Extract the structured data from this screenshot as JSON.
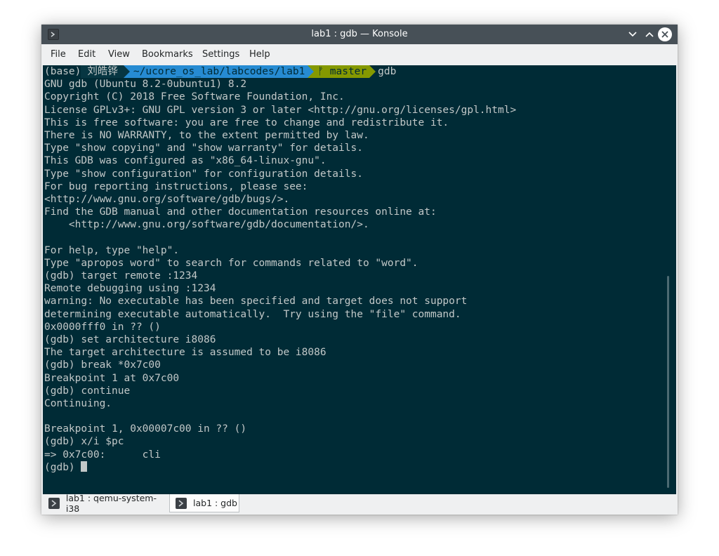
{
  "window": {
    "title": "lab1 : gdb — Konsole"
  },
  "menu": [
    "File",
    "Edit",
    "View",
    "Bookmarks",
    "Settings",
    "Help"
  ],
  "prompt": {
    "env": "(base)",
    "user": "刘皓铧",
    "directory": "~/ucore_os_lab/labcodes/lab1",
    "git_branch": "master",
    "git_icon": "ᚠ",
    "command": "gdb"
  },
  "terminal_lines": [
    "GNU gdb (Ubuntu 8.2-0ubuntu1) 8.2",
    "Copyright (C) 2018 Free Software Foundation, Inc.",
    "License GPLv3+: GNU GPL version 3 or later <http://gnu.org/licenses/gpl.html>",
    "This is free software: you are free to change and redistribute it.",
    "There is NO WARRANTY, to the extent permitted by law.",
    "Type \"show copying\" and \"show warranty\" for details.",
    "This GDB was configured as \"x86_64-linux-gnu\".",
    "Type \"show configuration\" for configuration details.",
    "For bug reporting instructions, please see:",
    "<http://www.gnu.org/software/gdb/bugs/>.",
    "Find the GDB manual and other documentation resources online at:",
    "    <http://www.gnu.org/software/gdb/documentation/>.",
    "",
    "For help, type \"help\".",
    "Type \"apropos word\" to search for commands related to \"word\".",
    "(gdb) target remote :1234",
    "Remote debugging using :1234",
    "warning: No executable has been specified and target does not support",
    "determining executable automatically.  Try using the \"file\" command.",
    "0x0000fff0 in ?? ()",
    "(gdb) set architecture i8086",
    "The target architecture is assumed to be i8086",
    "(gdb) break *0x7c00",
    "Breakpoint 1 at 0x7c00",
    "(gdb) continue",
    "Continuing.",
    "",
    "Breakpoint 1, 0x00007c00 in ?? ()",
    "(gdb) x/i $pc",
    "=> 0x7c00:      cli"
  ],
  "current_prompt": "(gdb) ",
  "tabs": [
    {
      "label": "lab1 : qemu-system-i38"
    },
    {
      "label": "lab1 : gdb"
    }
  ],
  "colors": {
    "terminal_bg": "#002b36",
    "terminal_fg": "#c2c8c8",
    "dir_segment": "#268bd2",
    "git_segment": "#859900",
    "titlebar": "#475057"
  }
}
